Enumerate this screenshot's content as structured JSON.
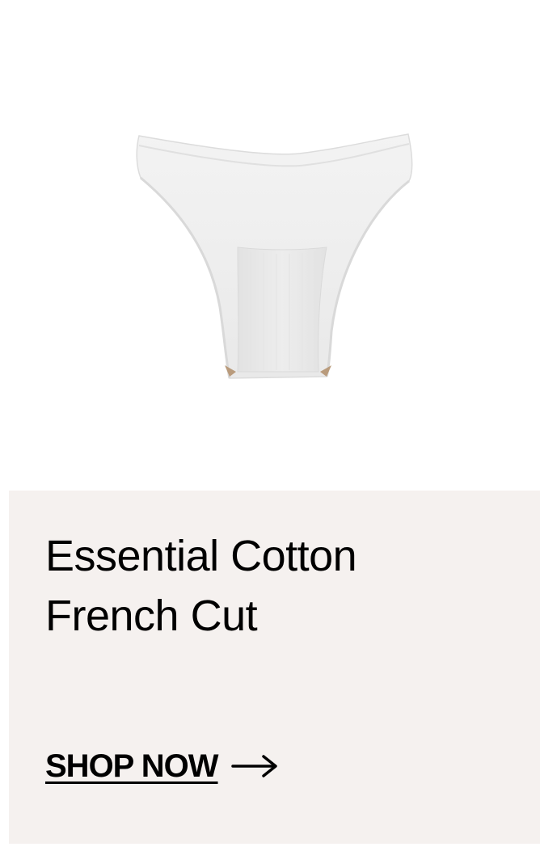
{
  "product": {
    "image_alt": "White cotton french cut brief",
    "title_line1": "Essential Cotton",
    "title_line2": "French Cut"
  },
  "cta": {
    "label": "SHOP NOW",
    "icon": "arrow-right-icon"
  },
  "colors": {
    "card_background": "#f5f1ef",
    "page_background": "#ffffff",
    "text": "#000000"
  }
}
